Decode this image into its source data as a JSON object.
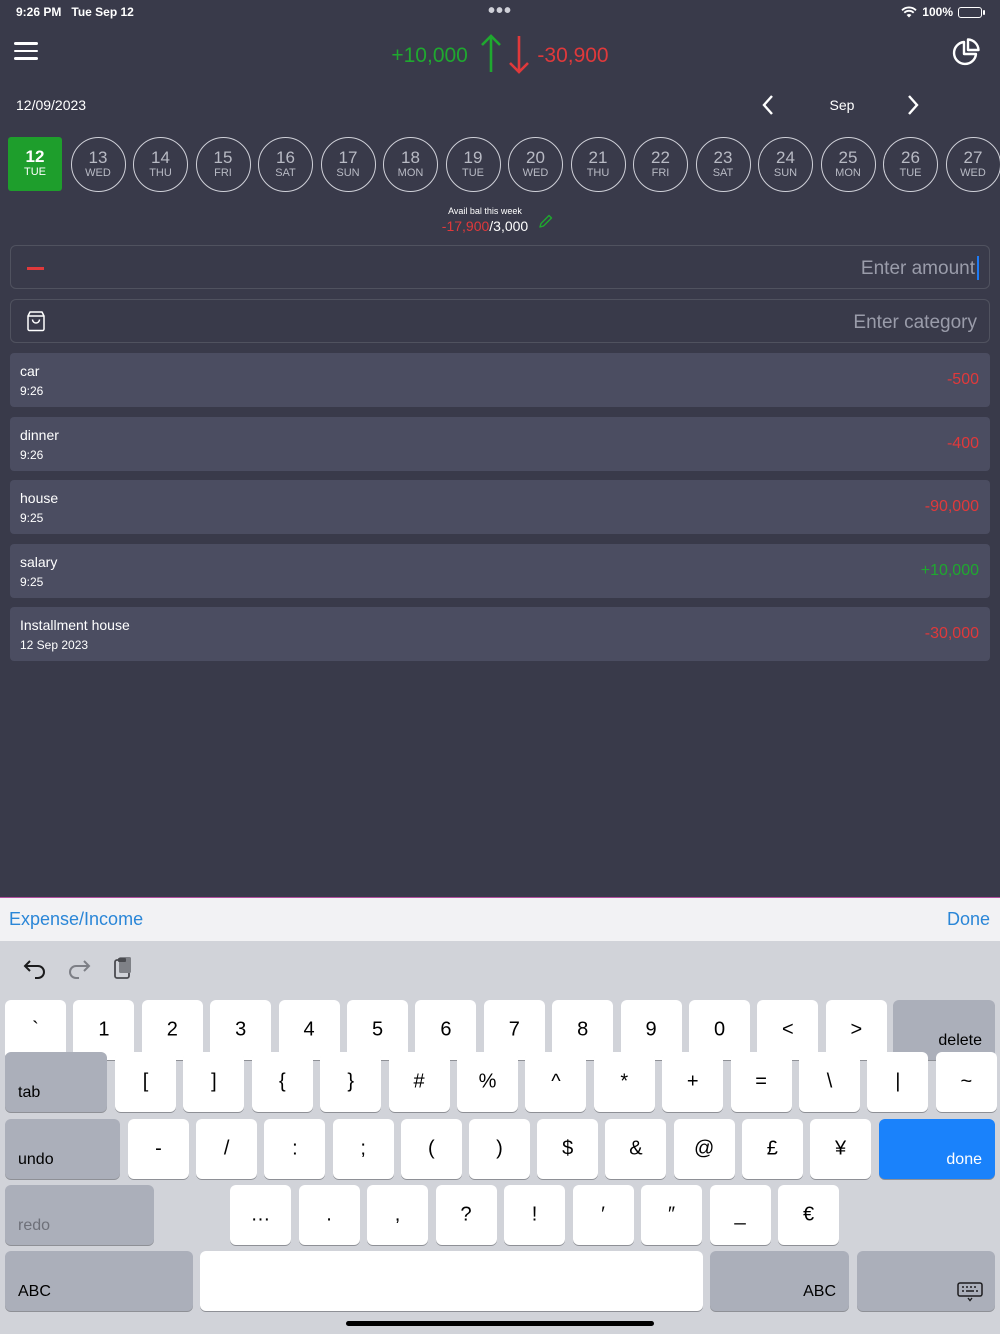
{
  "status_bar": {
    "time": "9:26 PM",
    "date": "Tue Sep 12",
    "battery": "100%"
  },
  "header": {
    "income_total": "+10,000",
    "expense_total": "-30,900",
    "menu_icon": "hamburger-icon",
    "chart_icon": "pie-chart-icon"
  },
  "date_label": "12/09/2023",
  "month_nav": {
    "month": "Sep"
  },
  "days": [
    {
      "num": "12",
      "dow": "TUE",
      "selected": true
    },
    {
      "num": "13",
      "dow": "WED"
    },
    {
      "num": "14",
      "dow": "THU"
    },
    {
      "num": "15",
      "dow": "FRI"
    },
    {
      "num": "16",
      "dow": "SAT"
    },
    {
      "num": "17",
      "dow": "SUN"
    },
    {
      "num": "18",
      "dow": "MON"
    },
    {
      "num": "19",
      "dow": "TUE"
    },
    {
      "num": "20",
      "dow": "WED"
    },
    {
      "num": "21",
      "dow": "THU"
    },
    {
      "num": "22",
      "dow": "FRI"
    },
    {
      "num": "23",
      "dow": "SAT"
    },
    {
      "num": "24",
      "dow": "SUN"
    },
    {
      "num": "25",
      "dow": "MON"
    },
    {
      "num": "26",
      "dow": "TUE"
    },
    {
      "num": "27",
      "dow": "WED"
    }
  ],
  "avail": {
    "label": "Avail bal this week",
    "spent": "-17,900",
    "limit": "/3,000"
  },
  "amount_field": {
    "placeholder": "Enter amount"
  },
  "category_field": {
    "placeholder": "Enter category"
  },
  "transactions": [
    {
      "name": "car",
      "time": "9:26",
      "amount": "-500",
      "type": "neg"
    },
    {
      "name": "dinner",
      "time": "9:26",
      "amount": "-400",
      "type": "neg"
    },
    {
      "name": "house",
      "time": "9:25",
      "amount": "-90,000",
      "type": "neg"
    },
    {
      "name": "salary",
      "time": "9:25",
      "amount": "+10,000",
      "type": "pos"
    },
    {
      "name": "Installment house",
      "time": "12 Sep 2023",
      "amount": "-30,000",
      "type": "neg"
    }
  ],
  "accessory": {
    "left": "Expense/Income",
    "right": "Done"
  },
  "keyboard": {
    "row1": [
      "`",
      "1",
      "2",
      "3",
      "4",
      "5",
      "6",
      "7",
      "8",
      "9",
      "0",
      "<",
      ">"
    ],
    "delete": "delete",
    "tab": "tab",
    "row2": [
      "[",
      "]",
      "{",
      "}",
      "#",
      "%",
      "^",
      "*",
      "+",
      "=",
      "\\",
      "|",
      "~"
    ],
    "undo": "undo",
    "row3": [
      "-",
      "/",
      ":",
      ";",
      "(",
      ")",
      "$",
      "&",
      "@",
      "£",
      "¥"
    ],
    "done": "done",
    "redo": "redo",
    "row4": [
      "…",
      ".",
      ",",
      "?",
      "!",
      "′",
      "″",
      "_",
      "€"
    ],
    "abc_left": "ABC",
    "abc_right": "ABC"
  },
  "colors": {
    "income": "#1fa82f",
    "expense": "#e0393b",
    "accent": "#2a86d7",
    "done_key": "#1a82fb"
  }
}
